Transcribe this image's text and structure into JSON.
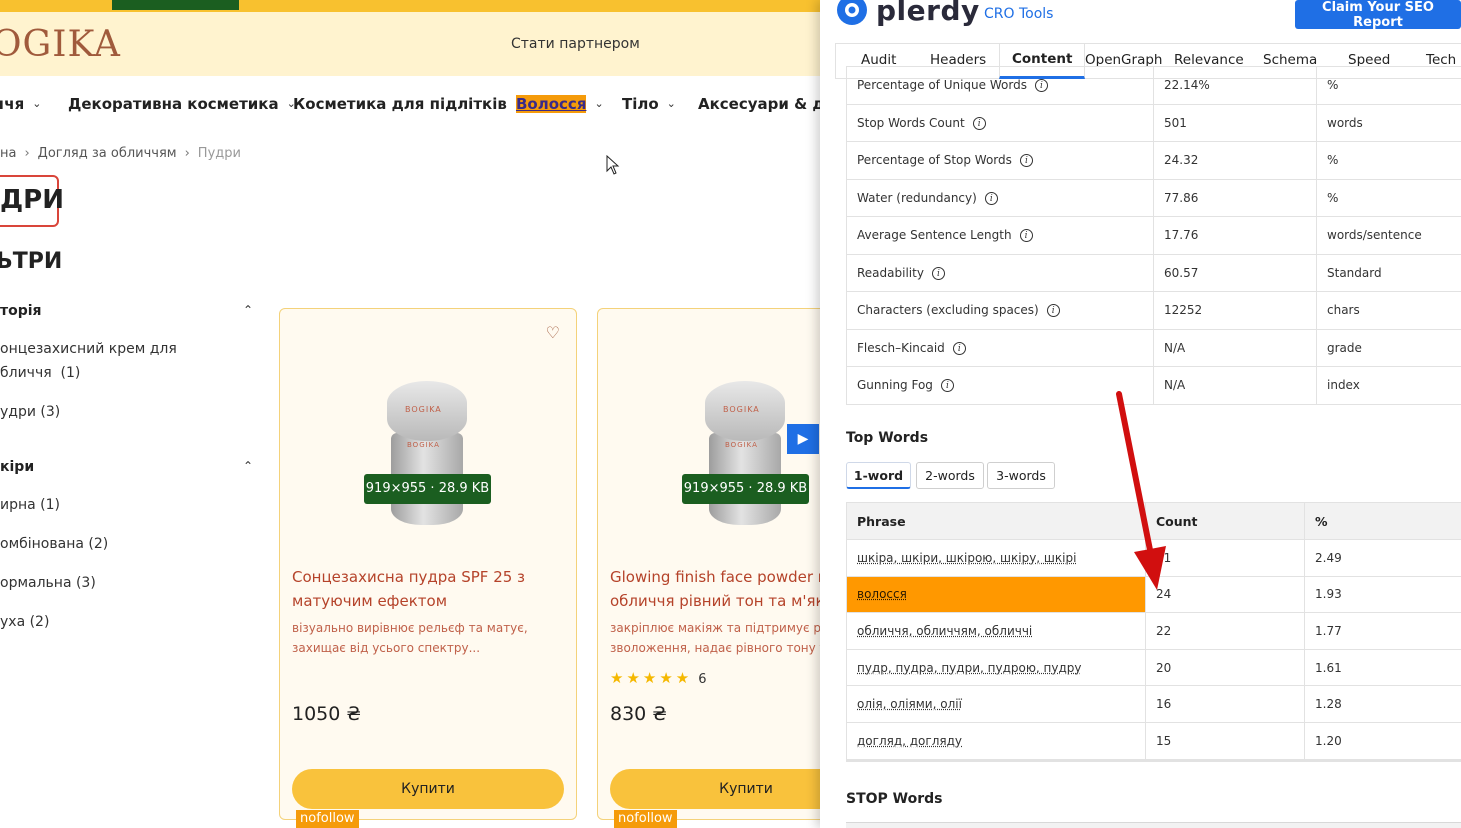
{
  "site": {
    "logo": "OGIKA",
    "partner_link": "Стати партнером",
    "nav": [
      {
        "label": "ччя"
      },
      {
        "label": "Декоративна косметика"
      },
      {
        "label": "Косметика для підлітків"
      },
      {
        "label": "Волосся"
      },
      {
        "label": "Тіло"
      },
      {
        "label": "Аксесуари & дім"
      }
    ],
    "breadcrumb": [
      "на",
      "Догляд за обличчям",
      "Пудри"
    ],
    "page_title": "ДРИ",
    "filters_title": "ЬТРИ",
    "filter_groups": [
      {
        "title": "торія",
        "items": [
          "онцезахисний крем для\nбличчя  (1)",
          "удри  (3)"
        ]
      },
      {
        "title": "кіри",
        "items": [
          "ирна  (1)",
          "омбінована  (2)",
          "ормальна  (3)",
          "уха  (2)"
        ]
      }
    ],
    "products": [
      {
        "jar_label": "BOGIKA",
        "image_badge": "919×955 · 28.9 KB",
        "title": "Сонцезахисна пудра SPF 25 з матуючим ефектом",
        "desc": "візуально вирівнює рельєф та матує, захищає від усього спектру...",
        "rating_stars": 0,
        "rating_count": "",
        "price": "1050 ₴",
        "buy_label": "Купити",
        "nofollow": "nofollow"
      },
      {
        "jar_label": "BOGIKA",
        "image_badge": "919×955 · 28.9 KB",
        "title": "Glowing finish face powder пу\nобличчя рівний тон та м'яке с",
        "desc": "закріплює макіяж та підтримує рів\nзволоження, надає рівного тону та",
        "rating_stars": 5,
        "rating_count": "6",
        "price": "830 ₴",
        "buy_label": "Купити",
        "nofollow": "nofollow"
      }
    ]
  },
  "panel": {
    "brand": "plerdy",
    "cro_tools": "CRO Tools",
    "claim_button": "Claim Your SEO Report",
    "tabs": [
      "Audit",
      "Headers",
      "Content",
      "OpenGraph",
      "Relevance",
      "Schema",
      "Speed",
      "Tech"
    ],
    "active_tab": "Content",
    "metrics": [
      {
        "name": "Percentage of Unique Words",
        "value": "22.14%",
        "unit": "%"
      },
      {
        "name": "Stop Words Count",
        "value": "501",
        "unit": "words"
      },
      {
        "name": "Percentage of Stop Words",
        "value": "24.32",
        "unit": "%"
      },
      {
        "name": "Water (redundancy)",
        "value": "77.86",
        "unit": "%"
      },
      {
        "name": "Average Sentence Length",
        "value": "17.76",
        "unit": "words/sentence"
      },
      {
        "name": "Readability",
        "value": "60.57",
        "unit": "Standard"
      },
      {
        "name": "Characters (excluding spaces)",
        "value": "12252",
        "unit": "chars"
      },
      {
        "name": "Flesch–Kincaid",
        "value": "N/A",
        "unit": "grade"
      },
      {
        "name": "Gunning Fog",
        "value": "N/A",
        "unit": "index"
      }
    ],
    "top_words_title": "Top Words",
    "word_buttons": [
      "1-word",
      "2-words",
      "3-words"
    ],
    "word_table_headers": [
      "Phrase",
      "Count",
      "%"
    ],
    "words": [
      {
        "phrase": "шкіра, шкіри, шкірою, шкіру, шкірі",
        "count": "31",
        "pct": "2.49"
      },
      {
        "phrase": "волосся",
        "count": "24",
        "pct": "1.93"
      },
      {
        "phrase": "обличчя, обличчям, обличчі",
        "count": "22",
        "pct": "1.77"
      },
      {
        "phrase": "пудр, пудра, пудри, пудрою, пудру",
        "count": "20",
        "pct": "1.61"
      },
      {
        "phrase": "олія, оліями, олії",
        "count": "16",
        "pct": "1.28"
      },
      {
        "phrase": "догляд, догляду",
        "count": "15",
        "pct": "1.20"
      }
    ],
    "stop_words_title": "STOP Words"
  },
  "colors": {
    "accent_blue": "#1f6fe5",
    "highlight_orange": "#ff9800",
    "site_yellow": "#f9c23c",
    "arrow_red": "#d10f0f"
  }
}
